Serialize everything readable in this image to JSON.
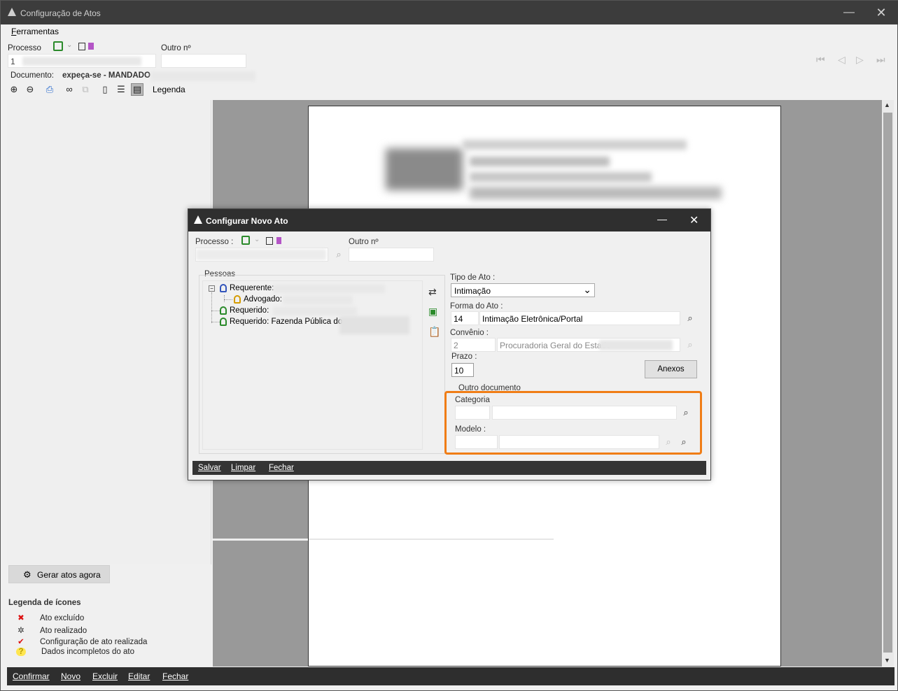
{
  "main": {
    "title": "Configuração de Atos",
    "menu": {
      "ferramentas_first": "F",
      "ferramentas_rest": "erramentas"
    },
    "processo_label": "Processo",
    "processo_value": "1",
    "outro_label": "Outro nº",
    "documento_label": "Documento:",
    "documento_value": "expeça-se - MANDADO",
    "legenda_label": "Legenda"
  },
  "left_panel": {
    "gerar_label": "Gerar atos agora",
    "legend_title": "Legenda de ícones",
    "legend_items": [
      {
        "icon": "x-icon",
        "glyph": "✖",
        "color": "#d11",
        "label": "Ato excluído"
      },
      {
        "icon": "gear-icon",
        "glyph": "✲",
        "color": "#333",
        "label": "Ato realizado"
      },
      {
        "icon": "check-icon",
        "glyph": "✔",
        "color": "#d11",
        "label": "Configuração de ato realizada"
      },
      {
        "icon": "question-icon",
        "glyph": "?",
        "color": "#b59a00",
        "label": "Dados incompletos do ato"
      }
    ]
  },
  "bottom_bar": {
    "confirmar": "Confirmar",
    "novo": "Novo",
    "excluir": "Excluir",
    "editar": "Editar",
    "fechar": "Fechar"
  },
  "dialog": {
    "title": "Configurar Novo Ato",
    "processo_label": "Processo :",
    "outro_label": "Outro nº",
    "pessoas_label": "Pessoas",
    "tree": [
      {
        "label": "Requerente:",
        "color": "#3355bb"
      },
      {
        "label": "Advogado:",
        "color": "#d49b00"
      },
      {
        "label": "Requerido: ",
        "color": "#2a8a2a"
      },
      {
        "label": "Requerido: Fazenda Pública do",
        "color": "#2a8a2a"
      }
    ],
    "tipo_label": "Tipo de Ato :",
    "tipo_value": "Intimação",
    "forma_label": "Forma do Ato :",
    "forma_code": "14",
    "forma_value": "Intimação Eletrônica/Portal",
    "convenio_label": "Convênio :",
    "convenio_code": "2",
    "convenio_value": "Procuradoria Geral do Estado",
    "prazo_label": "Prazo :",
    "prazo_value": "10",
    "anexos_label": "Anexos",
    "outro_documento_label": "Outro documento",
    "categoria_label": "Categoria",
    "modelo_label": "Modelo :",
    "footer": {
      "salvar": "Salvar",
      "limpar": "Limpar",
      "fechar": "Fechar"
    }
  }
}
